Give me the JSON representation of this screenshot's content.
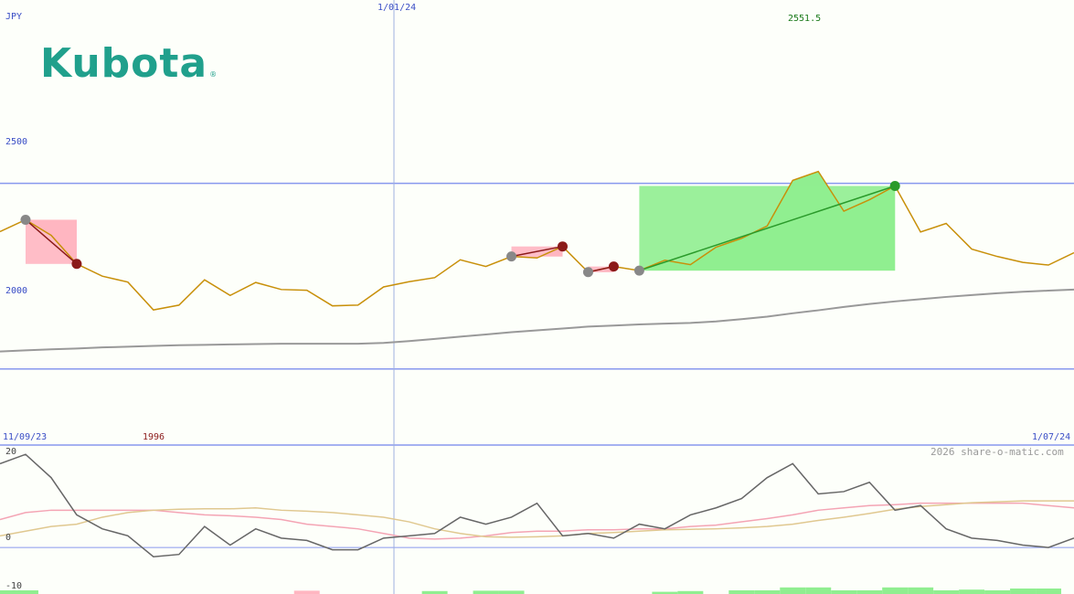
{
  "logo": {
    "text": "Kubota",
    "mark": "®",
    "color": "#20a08c"
  },
  "labels": {
    "currency": "JPY",
    "date_mid": "1/01/24",
    "last_value": "2551.5",
    "y_upper": "2500",
    "y_lower": "2000",
    "date_start": "11/09/23",
    "low_value": "1996",
    "date_end": "1/07/24",
    "watermark": "2026 share-o-matic.com",
    "osc_upper": "20",
    "osc_zero": "0",
    "osc_lower": "-10"
  },
  "colors": {
    "price": "#c8900a",
    "ma": "#999999",
    "gain": "#90ee90",
    "loss": "#ffb6c1",
    "gridline": "#8899ee",
    "osc_line": "#666666",
    "osc_pink": "#f4a4b4",
    "osc_tan": "#e0c890",
    "trade_up": "#2a9a2a",
    "trade_down": "#8b1a1a"
  },
  "chart_data": {
    "type": "line",
    "price_series": {
      "name": "",
      "values": [
        2370,
        2402,
        2360,
        2283,
        2250,
        2234,
        2159,
        2172,
        2240,
        2198,
        2233,
        2214,
        2212,
        2170,
        2172,
        2221,
        2235,
        2246,
        2294,
        2276,
        2303,
        2299,
        2330,
        2261,
        2276,
        2265,
        2293,
        2281,
        2328,
        2352,
        2385,
        2508,
        2532,
        2425,
        2456,
        2493,
        2369,
        2392,
        2323,
        2303,
        2287,
        2280,
        2313
      ]
    },
    "ma_series": {
      "name": "",
      "values": [
        2047,
        2050,
        2053,
        2055,
        2058,
        2060,
        2062,
        2064,
        2065,
        2066,
        2067,
        2068,
        2068,
        2068,
        2068,
        2070,
        2075,
        2081,
        2087,
        2093,
        2099,
        2104,
        2109,
        2114,
        2117,
        2120,
        2122,
        2124,
        2128,
        2134,
        2141,
        2150,
        2158,
        2167,
        2175,
        2182,
        2188,
        2194,
        2199,
        2204,
        2208,
        2211,
        2214
      ]
    },
    "y_gridlines": [
      2000,
      2500
    ],
    "ylim": [
      1795,
      2994
    ],
    "oscillator": {
      "black": [
        18,
        20,
        15,
        7,
        4,
        2.5,
        -2,
        -1.5,
        4.5,
        0.5,
        4,
        2,
        1.5,
        -0.5,
        -0.5,
        2,
        2.5,
        3,
        6.5,
        5,
        6.5,
        9.5,
        2.5,
        3,
        2,
        5,
        4,
        7,
        8.5,
        10.5,
        15,
        18,
        11.5,
        12,
        14,
        8,
        9,
        4,
        2,
        1.5,
        0.5,
        0,
        2
      ],
      "pink": [
        6,
        7.5,
        8,
        8,
        8,
        8,
        8,
        7.5,
        7,
        6.8,
        6.5,
        6,
        5,
        4.5,
        4,
        3,
        2,
        1.8,
        2,
        2.5,
        3.2,
        3.5,
        3.5,
        3.8,
        3.8,
        4,
        4,
        4.5,
        4.8,
        5.5,
        6.2,
        7,
        8,
        8.5,
        9,
        9.2,
        9.5,
        9.5,
        9.5,
        9.5,
        9.5,
        9,
        8.5
      ],
      "tan": [
        2.5,
        3.5,
        4.5,
        5,
        6.5,
        7.5,
        8,
        8.2,
        8.3,
        8.3,
        8.5,
        8,
        7.8,
        7.5,
        7,
        6.5,
        5.5,
        4,
        3,
        2.3,
        2.2,
        2.3,
        2.5,
        3,
        3.2,
        3.5,
        3.8,
        3.9,
        4,
        4.2,
        4.5,
        5,
        5.8,
        6.5,
        7.3,
        8.2,
        8.8,
        9.2,
        9.6,
        9.8,
        10,
        10,
        10
      ],
      "ylim": [
        -10,
        22
      ],
      "gridlines": [
        0
      ]
    },
    "volume_bars": [
      {
        "i": 0,
        "v": 1.0,
        "type": "up"
      },
      {
        "i": 1,
        "v": 1.0,
        "type": "up"
      },
      {
        "i": 12,
        "v": 0.9,
        "type": "down"
      },
      {
        "i": 17,
        "v": 0.8,
        "type": "up"
      },
      {
        "i": 19,
        "v": 0.9,
        "type": "up"
      },
      {
        "i": 20,
        "v": 0.9,
        "type": "up"
      },
      {
        "i": 26,
        "v": 0.6,
        "type": "up"
      },
      {
        "i": 27,
        "v": 0.8,
        "type": "up"
      },
      {
        "i": 29,
        "v": 1.0,
        "type": "up"
      },
      {
        "i": 30,
        "v": 1.0,
        "type": "up"
      },
      {
        "i": 31,
        "v": 1.8,
        "type": "up"
      },
      {
        "i": 32,
        "v": 1.8,
        "type": "up"
      },
      {
        "i": 33,
        "v": 1.0,
        "type": "up"
      },
      {
        "i": 34,
        "v": 1.0,
        "type": "up"
      },
      {
        "i": 35,
        "v": 1.8,
        "type": "up"
      },
      {
        "i": 36,
        "v": 1.8,
        "type": "up"
      },
      {
        "i": 37,
        "v": 1.0,
        "type": "up"
      },
      {
        "i": 38,
        "v": 1.2,
        "type": "up"
      },
      {
        "i": 39,
        "v": 1.0,
        "type": "up"
      },
      {
        "i": 40,
        "v": 1.5,
        "type": "up"
      },
      {
        "i": 41,
        "v": 1.5,
        "type": "up"
      }
    ],
    "trades": [
      {
        "entry": 1,
        "exit": 3,
        "result": "loss"
      },
      {
        "entry": 20,
        "exit": 22,
        "result": "loss"
      },
      {
        "entry": 23,
        "exit": 24,
        "result": "loss"
      },
      {
        "entry": 25,
        "exit": 35,
        "result": "gain"
      }
    ],
    "xlim": [
      0,
      41
    ]
  }
}
